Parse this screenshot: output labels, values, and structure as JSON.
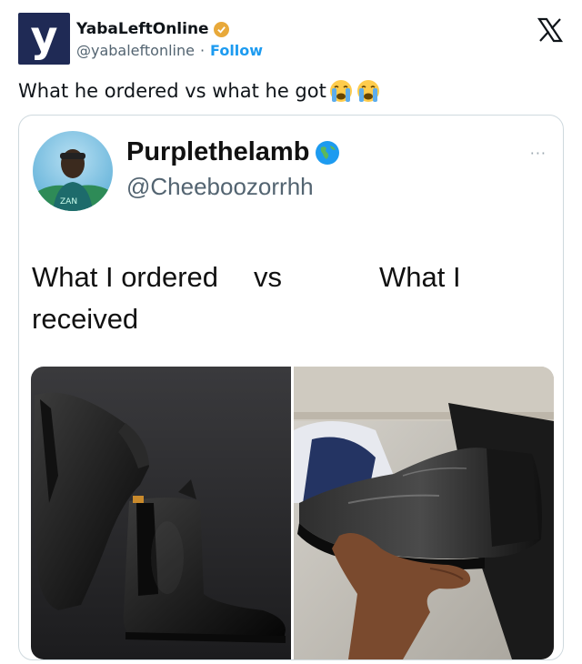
{
  "header": {
    "logo_letter": "y",
    "account_name": "YabaLeftOnline",
    "handle": "@yabaleftonline",
    "separator": "·",
    "follow_label": "Follow"
  },
  "tweet": {
    "text": "What he ordered vs what he got",
    "emojis": [
      "crying-face",
      "crying-face"
    ]
  },
  "embedded_post": {
    "name": "Purplethelamb",
    "handle": "@Cheeboozorrhh",
    "more": "···",
    "text_line1_left": "What I ordered",
    "text_line1_mid": "vs",
    "text_line1_right": "What I",
    "text_line2": "received"
  },
  "colors": {
    "logo_bg": "#1f2a55",
    "verified_badge": "#e8a93a",
    "follow": "#1d9bf0",
    "handle_gray": "#536471"
  }
}
